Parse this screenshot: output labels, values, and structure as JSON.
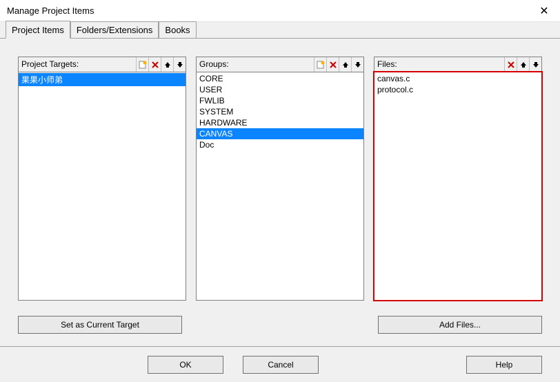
{
  "title": "Manage Project Items",
  "tabs": {
    "t0": "Project Items",
    "t1": "Folders/Extensions",
    "t2": "Books"
  },
  "panels": {
    "targets": {
      "label": "Project Targets:",
      "items": [
        "果果小师弟"
      ],
      "selected": 0
    },
    "groups": {
      "label": "Groups:",
      "items": [
        "CORE",
        "USER",
        "FWLIB",
        "SYSTEM",
        "HARDWARE",
        "CANVAS",
        "Doc"
      ],
      "selected": 5
    },
    "files": {
      "label": "Files:",
      "items": [
        "canvas.c",
        "protocol.c"
      ],
      "selected": -1
    }
  },
  "buttons": {
    "set_target": "Set as Current Target",
    "add_files": "Add Files...",
    "ok": "OK",
    "cancel": "Cancel",
    "help": "Help"
  },
  "icons": {
    "new": "new",
    "delete": "delete",
    "up": "up",
    "down": "down"
  }
}
